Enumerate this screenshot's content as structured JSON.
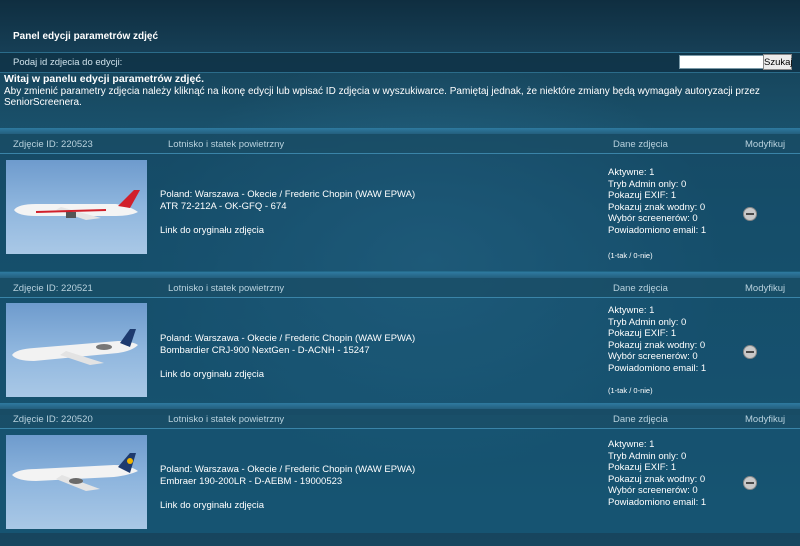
{
  "panel": {
    "title": "Panel edycji parametrów zdjęć"
  },
  "search": {
    "label": "Podaj id zdjecia do edycji:",
    "placeholder": "",
    "value": "",
    "button": "Szukaj"
  },
  "intro": {
    "welcome": "Witaj w panelu edycji parametrów zdjęć.",
    "text": "Aby zmienić parametry zdjęcia należy kliknąć na ikonę edycji lub wpisać ID zdjęcia w wyszukiwarce. Pamiętaj jednak, że niektóre zmiany będą wymagały autoryzacji przez SeniorScreenera."
  },
  "columns": {
    "airport": "Lotnisko i statek powietrzny",
    "data": "Dane zdjęcia",
    "modify": "Modyfikuj"
  },
  "records": [
    {
      "id_label": "Zdjęcie ID: 220523",
      "location": "Poland: Warszawa - Okecie / Frederic Chopin (WAW EPWA)",
      "aircraft": "ATR 72-212A - OK-GFQ - 674",
      "link": "Link do oryginału zdjęcia",
      "data": [
        "Aktywne: 1",
        "Tryb Admin only: 0",
        "Pokazuj EXIF: 1",
        "Pokazuj znak wodny: 0",
        "Wybór screenerów: 0",
        "Powiadomiono email: 1"
      ],
      "legend": "(1-tak / 0-nie)",
      "livery": "#d11f2a"
    },
    {
      "id_label": "Zdjęcie ID: 220521",
      "location": "Poland: Warszawa - Okecie / Frederic Chopin (WAW EPWA)",
      "aircraft": "Bombardier CRJ-900 NextGen - D-ACNH - 15247",
      "link": "Link do oryginału zdjęcia",
      "data": [
        "Aktywne: 1",
        "Tryb Admin only: 0",
        "Pokazuj EXIF: 1",
        "Pokazuj znak wodny: 0",
        "Wybór screenerów: 0",
        "Powiadomiono email: 1"
      ],
      "legend": "(1-tak / 0-nie)",
      "livery": "#1d3a6e"
    },
    {
      "id_label": "Zdjęcie ID: 220520",
      "location": "Poland: Warszawa - Okecie / Frederic Chopin (WAW EPWA)",
      "aircraft": "Embraer 190-200LR - D-AEBM - 19000523",
      "link": "Link do oryginału zdjęcia",
      "data": [
        "Aktywne: 1",
        "Tryb Admin only: 0",
        "Pokazuj EXIF: 1",
        "Pokazuj znak wodny: 0",
        "Wybór screenerów: 0",
        "Powiadomiono email: 1"
      ],
      "legend": "",
      "livery": "#1d3a6e"
    }
  ],
  "icons": {
    "modify": "minus-circle-icon"
  }
}
